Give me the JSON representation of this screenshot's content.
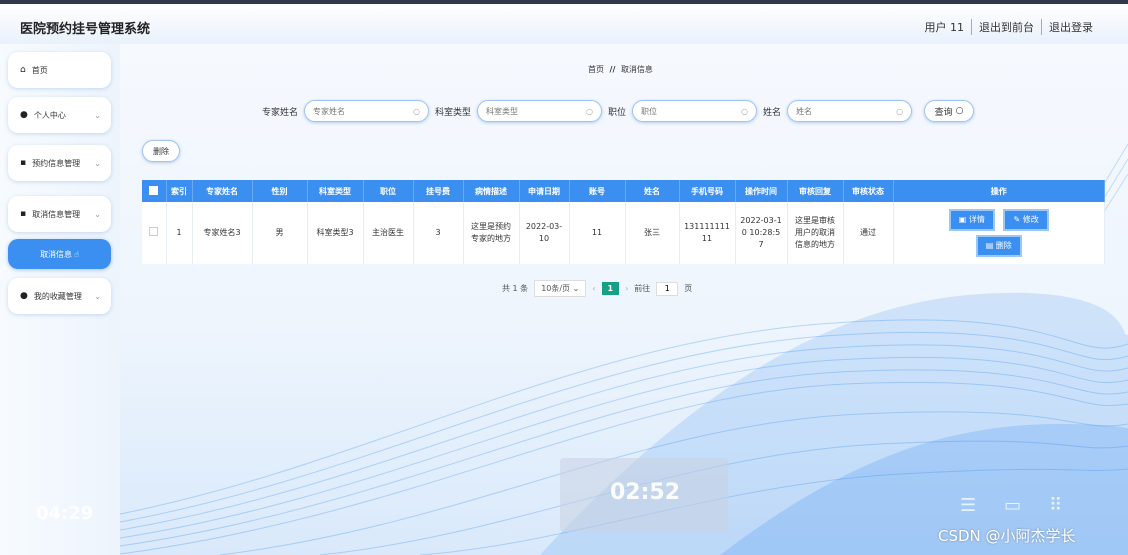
{
  "app": {
    "title": "医院预约挂号管理系统"
  },
  "topnav": {
    "user": "用户 11",
    "front": "退出到前台",
    "logout": "退出登录"
  },
  "sidebar": {
    "home": "首页",
    "personal": "个人中心",
    "appointment_mgmt": "预约信息管理",
    "cancel_mgmt": "取消信息管理",
    "cancel_info": "取消信息",
    "favorites_mgmt": "我的收藏管理"
  },
  "breadcrumb": {
    "home": "首页",
    "sep": "//",
    "current": "取消信息"
  },
  "search": {
    "expert_label": "专家姓名",
    "expert_placeholder": "专家姓名",
    "dept_label": "科室类型",
    "dept_placeholder": "科室类型",
    "title_label": "职位",
    "title_placeholder": "职位",
    "name_label": "姓名",
    "name_placeholder": "姓名",
    "query": "查询"
  },
  "actions": {
    "delete": "删除"
  },
  "table": {
    "headers": [
      "索引",
      "专家姓名",
      "性别",
      "科室类型",
      "职位",
      "挂号费",
      "病情描述",
      "申请日期",
      "账号",
      "姓名",
      "手机号码",
      "操作时间",
      "审核回复",
      "审核状态",
      "操作"
    ],
    "rows": [
      {
        "index": "1",
        "expert": "专家姓名3",
        "gender": "男",
        "dept": "科室类型3",
        "title": "主治医生",
        "fee": "3",
        "desc": "这里是预约专家的地方",
        "date": "2022-03-10",
        "account": "11",
        "name": "张三",
        "phone": "13111111111",
        "optime": "2022-03-10 10:28:57",
        "reply": "这里是审核用户的取消信息的地方",
        "status": "通过",
        "btn_detail": "详情",
        "btn_edit": "修改",
        "btn_delete": "删除"
      }
    ]
  },
  "pagination": {
    "total": "共 1 条",
    "size": "10条/页",
    "current": "1",
    "goto": "前往",
    "goto_value": "1",
    "unit": "页"
  },
  "overlay": {
    "clock_left": "04:29",
    "clock_mid": "02:52",
    "watermark": "CSDN @小阿杰学长"
  },
  "colors": {
    "accent": "#3b8ff0",
    "page_current": "#16a085"
  }
}
